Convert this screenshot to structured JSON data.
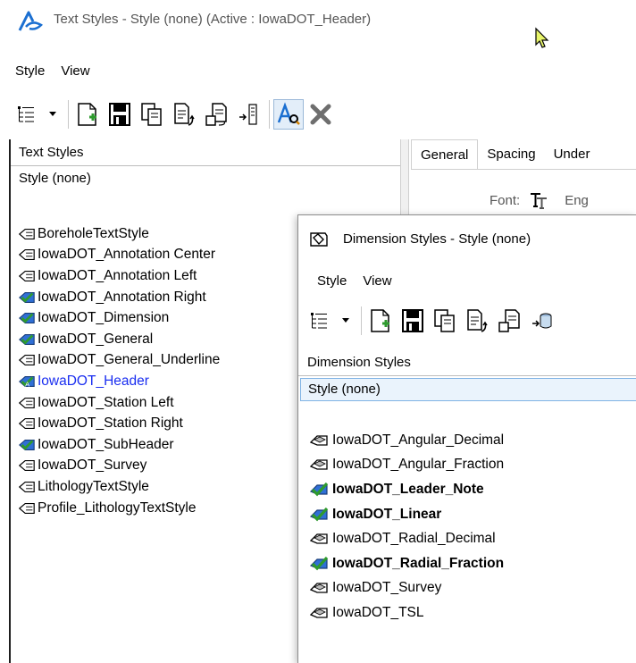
{
  "text_styles_window": {
    "title": "Text Styles - Style (none) (Active : IowaDOT_Header)",
    "menus": [
      "Style",
      "View"
    ],
    "panel_header": "Text Styles",
    "style_none": "Style (none)",
    "tabs": [
      "General",
      "Spacing",
      "Under"
    ],
    "font_label": "Font:",
    "font_value": "Eng",
    "styles": [
      {
        "label": "BoreholeTextStyle",
        "icon": "text-style-icon",
        "modified": false,
        "active": false
      },
      {
        "label": "IowaDOT_Annotation Center",
        "icon": "text-style-icon",
        "modified": false,
        "active": false
      },
      {
        "label": "IowaDOT_Annotation Left",
        "icon": "text-style-icon",
        "modified": false,
        "active": false
      },
      {
        "label": "IowaDOT_Annotation Right",
        "icon": "text-style-checked-icon",
        "modified": true,
        "active": false
      },
      {
        "label": "IowaDOT_Dimension",
        "icon": "text-style-checked-icon",
        "modified": true,
        "active": false
      },
      {
        "label": "IowaDOT_General",
        "icon": "text-style-checked-icon",
        "modified": true,
        "active": false
      },
      {
        "label": "IowaDOT_General_Underline",
        "icon": "text-style-icon",
        "modified": false,
        "active": false
      },
      {
        "label": "IowaDOT_Header",
        "icon": "text-style-active-icon",
        "modified": true,
        "active": true
      },
      {
        "label": "IowaDOT_Station Left",
        "icon": "text-style-icon",
        "modified": false,
        "active": false
      },
      {
        "label": "IowaDOT_Station Right",
        "icon": "text-style-icon",
        "modified": false,
        "active": false
      },
      {
        "label": "IowaDOT_SubHeader",
        "icon": "text-style-checked-icon",
        "modified": true,
        "active": false
      },
      {
        "label": "IowaDOT_Survey",
        "icon": "text-style-icon",
        "modified": false,
        "active": false
      },
      {
        "label": "LithologyTextStyle",
        "icon": "text-style-icon",
        "modified": false,
        "active": false
      },
      {
        "label": "Profile_LithologyTextStyle",
        "icon": "text-style-icon",
        "modified": false,
        "active": false
      }
    ]
  },
  "dimension_styles_window": {
    "title": "Dimension Styles -  Style (none)",
    "menus": [
      "Style",
      "View"
    ],
    "panel_header": "Dimension Styles",
    "style_none": "Style (none)",
    "styles": [
      {
        "label": "IowaDOT_Angular_Decimal",
        "icon": "dimension-style-icon",
        "bold": false
      },
      {
        "label": "IowaDOT_Angular_Fraction",
        "icon": "dimension-style-icon",
        "bold": false
      },
      {
        "label": "IowaDOT_Leader_Note",
        "icon": "dimension-style-checked-icon",
        "bold": true
      },
      {
        "label": "IowaDOT_Linear",
        "icon": "dimension-style-checked-icon",
        "bold": true
      },
      {
        "label": "IowaDOT_Radial_Decimal",
        "icon": "dimension-style-icon",
        "bold": false
      },
      {
        "label": "IowaDOT_Radial_Fraction",
        "icon": "dimension-style-checked-icon",
        "bold": true
      },
      {
        "label": "IowaDOT_Survey",
        "icon": "dimension-style-icon",
        "bold": false
      },
      {
        "label": "IowaDOT_TSL",
        "icon": "dimension-style-icon",
        "bold": false
      }
    ]
  },
  "colors": {
    "active_style_text": "#1a2ef0",
    "check_green": "#2e9a2e",
    "check_blue": "#2f6fd6",
    "logo_blue": "#1b6fd1"
  }
}
